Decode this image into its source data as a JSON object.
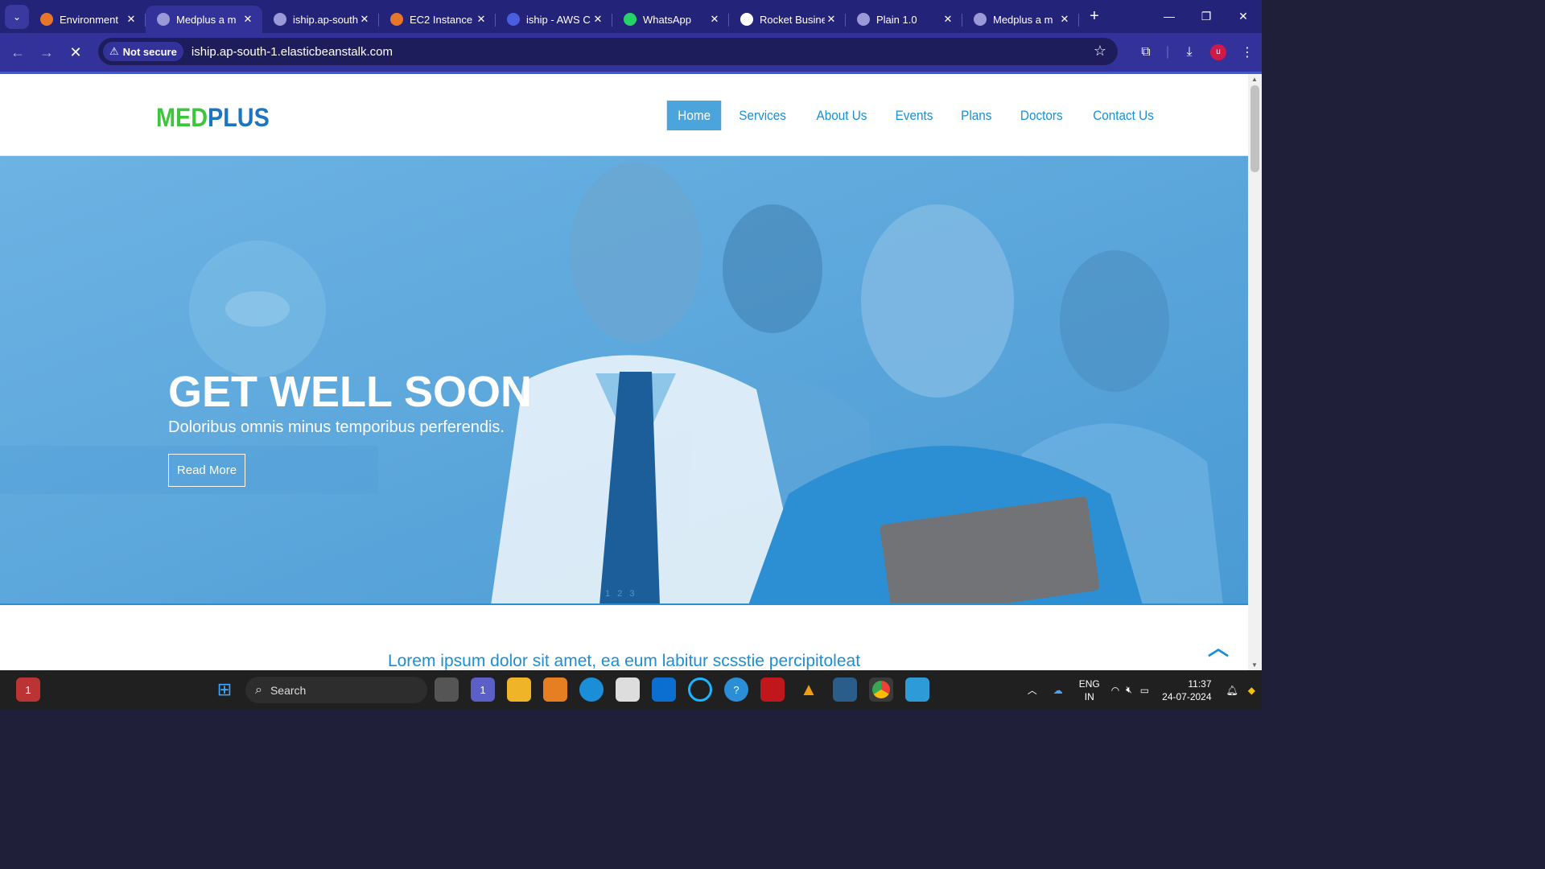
{
  "browser": {
    "tabs": [
      {
        "title": "Environment",
        "favicon": "orange-gear-icon",
        "color": "#e8762a",
        "active": false
      },
      {
        "title": "Medplus a m",
        "favicon": "globe-icon",
        "color": "#9a9ad8",
        "active": true
      },
      {
        "title": "iship.ap-south",
        "favicon": "globe-icon",
        "color": "#9a9ad8",
        "active": false
      },
      {
        "title": "EC2 Instance",
        "favicon": "aws-cube-icon",
        "color": "#e8762a",
        "active": false
      },
      {
        "title": "iship - AWS C",
        "favicon": "cloud-icon",
        "color": "#4a5fe0",
        "active": false
      },
      {
        "title": "WhatsApp",
        "favicon": "whatsapp-icon",
        "color": "#25d366",
        "active": false
      },
      {
        "title": "Rocket Busine",
        "favicon": "rocket-icon",
        "color": "#ffffff",
        "active": false
      },
      {
        "title": "Plain 1.0",
        "favicon": "globe-icon",
        "color": "#9a9ad8",
        "active": false
      },
      {
        "title": "Medplus a m",
        "favicon": "globe-icon",
        "color": "#9a9ad8",
        "active": false
      }
    ],
    "security_chip": "Not secure",
    "url": "iship.ap-south-1.elasticbeanstalk.com",
    "profile_initial": "u"
  },
  "site": {
    "logo_part1": "MED",
    "logo_part2": "PLUS",
    "nav": [
      {
        "label": "Home",
        "active": true
      },
      {
        "label": "Services",
        "active": false
      },
      {
        "label": "About Us",
        "active": false
      },
      {
        "label": "Events",
        "active": false
      },
      {
        "label": "Plans",
        "active": false
      },
      {
        "label": "Doctors",
        "active": false
      },
      {
        "label": "Contact Us",
        "active": false
      }
    ],
    "hero": {
      "title": "GET WELL SOON",
      "subtitle": "Doloribus omnis minus temporibus perferendis.",
      "button": "Read More",
      "dots": "1 2 3"
    },
    "section_heading": "Lorem ipsum dolor sit amet, ea eum labitur scsstie percipitoleat"
  },
  "taskbar": {
    "search_placeholder": "Search",
    "lang_line1": "ENG",
    "lang_line2": "IN",
    "time": "11:37",
    "date": "24-07-2024",
    "notification_badge": "1",
    "teams_badge": "1"
  }
}
